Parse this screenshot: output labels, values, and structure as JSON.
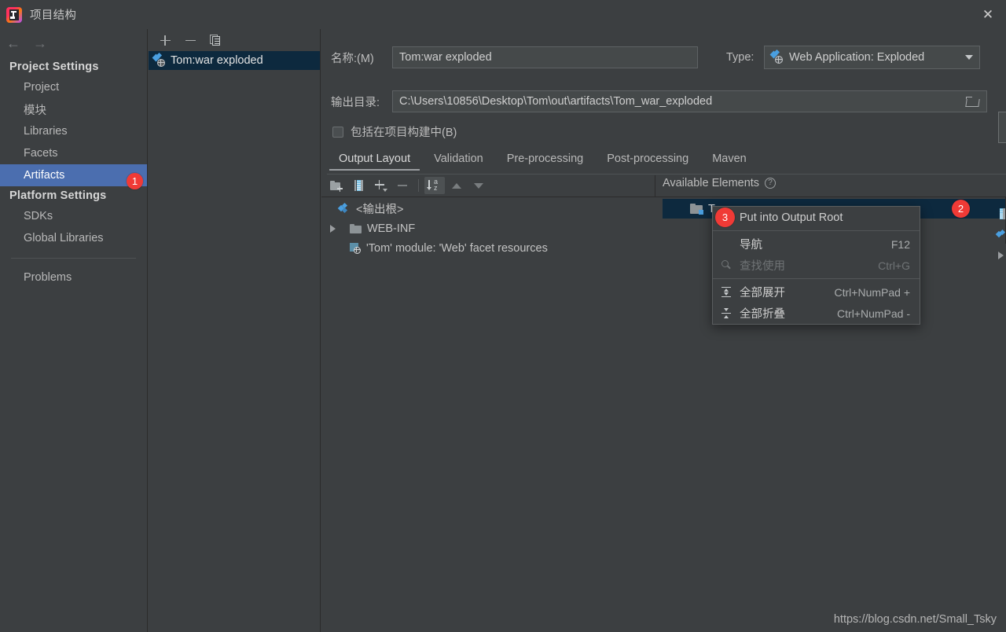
{
  "window": {
    "title": "项目结构",
    "logo_icon": "intellij-idea-logo",
    "close_icon": "close-icon"
  },
  "sidebar": {
    "nav": {
      "back_icon": "arrow-left-icon",
      "forward_icon": "arrow-right-icon"
    },
    "groups": [
      {
        "title": "Project Settings",
        "items": [
          {
            "label": "Project",
            "selected": false
          },
          {
            "label": "模块",
            "selected": false
          },
          {
            "label": "Libraries",
            "selected": false
          },
          {
            "label": "Facets",
            "selected": false
          },
          {
            "label": "Artifacts",
            "selected": true,
            "badge": "1"
          }
        ]
      },
      {
        "title": "Platform Settings",
        "items": [
          {
            "label": "SDKs",
            "selected": false
          },
          {
            "label": "Global Libraries",
            "selected": false
          }
        ]
      }
    ],
    "problems": "Problems"
  },
  "artifacts_panel": {
    "toolbar": {
      "add_icon": "plus-icon",
      "remove_icon": "minus-icon",
      "copy_icon": "copy-icon"
    },
    "items": [
      {
        "label": "Tom:war exploded",
        "icon": "web-exploded-artifact-icon",
        "selected": true
      }
    ]
  },
  "detail": {
    "name_label": "名称:(M)",
    "name_value": "Tom:war exploded",
    "type_label": "Type:",
    "type_value": "Web Application: Exploded",
    "type_icon": "web-exploded-artifact-icon",
    "output_label": "输出目录:",
    "output_value": "C:\\Users\\10856\\Desktop\\Tom\\out\\artifacts\\Tom_war_exploded",
    "browse_icon": "folder-browse-icon",
    "include_checkbox_label": "包括在项目构建中(B)",
    "include_checkbox_checked": false,
    "tabs": [
      {
        "label": "Output Layout",
        "active": true
      },
      {
        "label": "Validation",
        "active": false
      },
      {
        "label": "Pre-processing",
        "active": false
      },
      {
        "label": "Post-processing",
        "active": false
      },
      {
        "label": "Maven",
        "active": false
      }
    ],
    "layout_toolbar": [
      {
        "icon": "create-directory-icon"
      },
      {
        "icon": "create-archive-icon"
      },
      {
        "icon": "add-copy-of-icon"
      },
      {
        "icon": "remove-icon"
      },
      {
        "icon": "sort-alphabetically-icon"
      },
      {
        "icon": "move-up-icon"
      },
      {
        "icon": "move-down-icon"
      }
    ],
    "tree": [
      {
        "label": "<输出根>",
        "icon": "artifact-root-icon",
        "indent": 0,
        "expandable": false
      },
      {
        "label": "WEB-INF",
        "icon": "directory-icon",
        "indent": 0,
        "expandable": true
      },
      {
        "label": "'Tom' module: 'Web' facet resources",
        "icon": "facet-resources-icon",
        "indent": 1,
        "expandable": false
      }
    ],
    "available": {
      "label": "Available Elements",
      "help_icon": "help-icon",
      "item_label": "Tom",
      "item_icon": "module-output-folder-icon",
      "badge": "2"
    }
  },
  "context_menu": {
    "badge": "3",
    "items": [
      {
        "label": "Put into Output Root",
        "shortcut": "",
        "icon": "",
        "disabled": false
      },
      {
        "label": "导航",
        "shortcut": "F12",
        "icon": "",
        "disabled": false
      },
      {
        "label": "查找使用",
        "shortcut": "Ctrl+G",
        "icon": "search-icon",
        "disabled": true
      },
      {
        "label": "全部展开",
        "shortcut": "Ctrl+NumPad +",
        "icon": "expand-all-icon",
        "disabled": false
      },
      {
        "label": "全部折叠",
        "shortcut": "Ctrl+NumPad -",
        "icon": "collapse-all-icon",
        "disabled": false
      }
    ]
  },
  "watermark": "https://blog.csdn.net/Small_Tsky",
  "colors": {
    "background": "#3c3f41",
    "selection_blue": "#4b6eaf",
    "tree_selection": "#0d293e",
    "badge_red": "#f03a36",
    "accent_icon_blue": "#4a9fe0"
  }
}
